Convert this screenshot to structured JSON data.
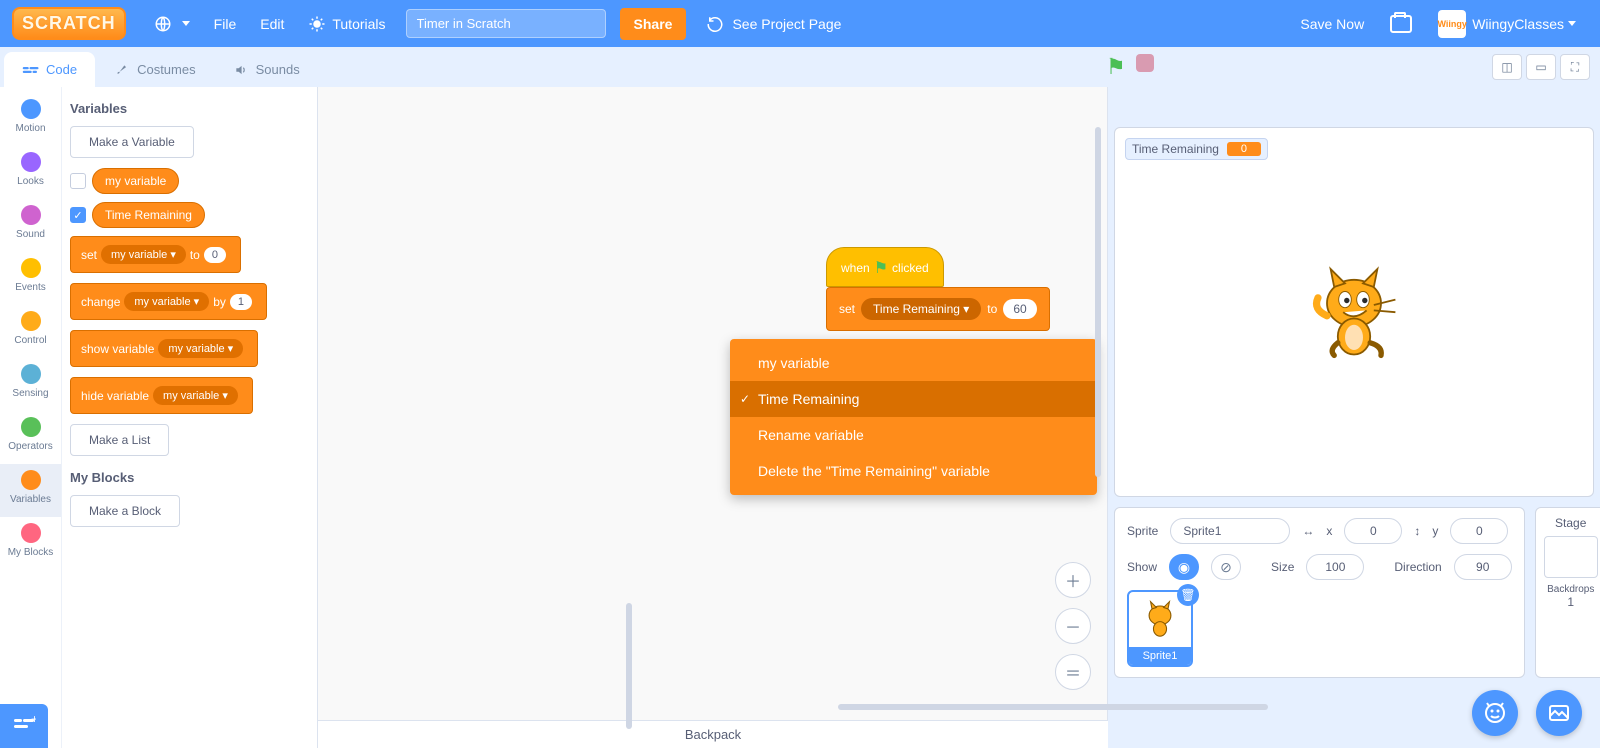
{
  "menubar": {
    "logo": "SCRATCH",
    "file": "File",
    "edit": "Edit",
    "tutorials": "Tutorials",
    "project_title": "Timer in Scratch",
    "share": "Share",
    "see_project": "See Project Page",
    "save_now": "Save Now",
    "username": "WiingyClasses",
    "avatar_text": "Wiingy"
  },
  "tabs": {
    "code": "Code",
    "costumes": "Costumes",
    "sounds": "Sounds"
  },
  "categories": [
    {
      "name": "Motion",
      "color": "#4c97ff"
    },
    {
      "name": "Looks",
      "color": "#9966ff"
    },
    {
      "name": "Sound",
      "color": "#cf63cf"
    },
    {
      "name": "Events",
      "color": "#ffbf00"
    },
    {
      "name": "Control",
      "color": "#ffab19"
    },
    {
      "name": "Sensing",
      "color": "#5cb1d6"
    },
    {
      "name": "Operators",
      "color": "#59c059"
    },
    {
      "name": "Variables",
      "color": "#ff8c1a"
    },
    {
      "name": "My Blocks",
      "color": "#ff6680"
    }
  ],
  "palette": {
    "variables_heading": "Variables",
    "make_variable": "Make a Variable",
    "vars": [
      {
        "name": "my variable",
        "checked": false
      },
      {
        "name": "Time Remaining",
        "checked": true
      }
    ],
    "set_label_a": "set",
    "set_dd": "my variable ▾",
    "set_label_b": "to",
    "set_val": "0",
    "change_label_a": "change",
    "change_dd": "my variable ▾",
    "change_label_b": "by",
    "change_val": "1",
    "show_label": "show variable",
    "show_dd": "my variable ▾",
    "hide_label": "hide variable",
    "hide_dd": "my variable ▾",
    "make_list": "Make a List",
    "myblocks_heading": "My Blocks",
    "make_block": "Make a Block"
  },
  "workspace": {
    "hat_a": "when",
    "hat_b": "clicked",
    "set_a": "set",
    "set_dd": "Time Remaining ▾",
    "set_b": "to",
    "set_val": "60"
  },
  "dropdown": {
    "opt1": "my variable",
    "opt2": "Time Remaining",
    "rename": "Rename variable",
    "delete": "Delete the \"Time Remaining\" variable"
  },
  "backpack": "Backpack",
  "stage": {
    "monitor_label": "Time Remaining",
    "monitor_value": "0"
  },
  "sprite_info": {
    "sprite_label": "Sprite",
    "sprite_name": "Sprite1",
    "x_label": "x",
    "x_val": "0",
    "y_label": "y",
    "y_val": "0",
    "show_label": "Show",
    "size_label": "Size",
    "size_val": "100",
    "direction_label": "Direction",
    "direction_val": "90",
    "thumb_label": "Sprite1"
  },
  "stage_panel": {
    "title": "Stage",
    "backdrops_label": "Backdrops",
    "backdrops_count": "1"
  }
}
